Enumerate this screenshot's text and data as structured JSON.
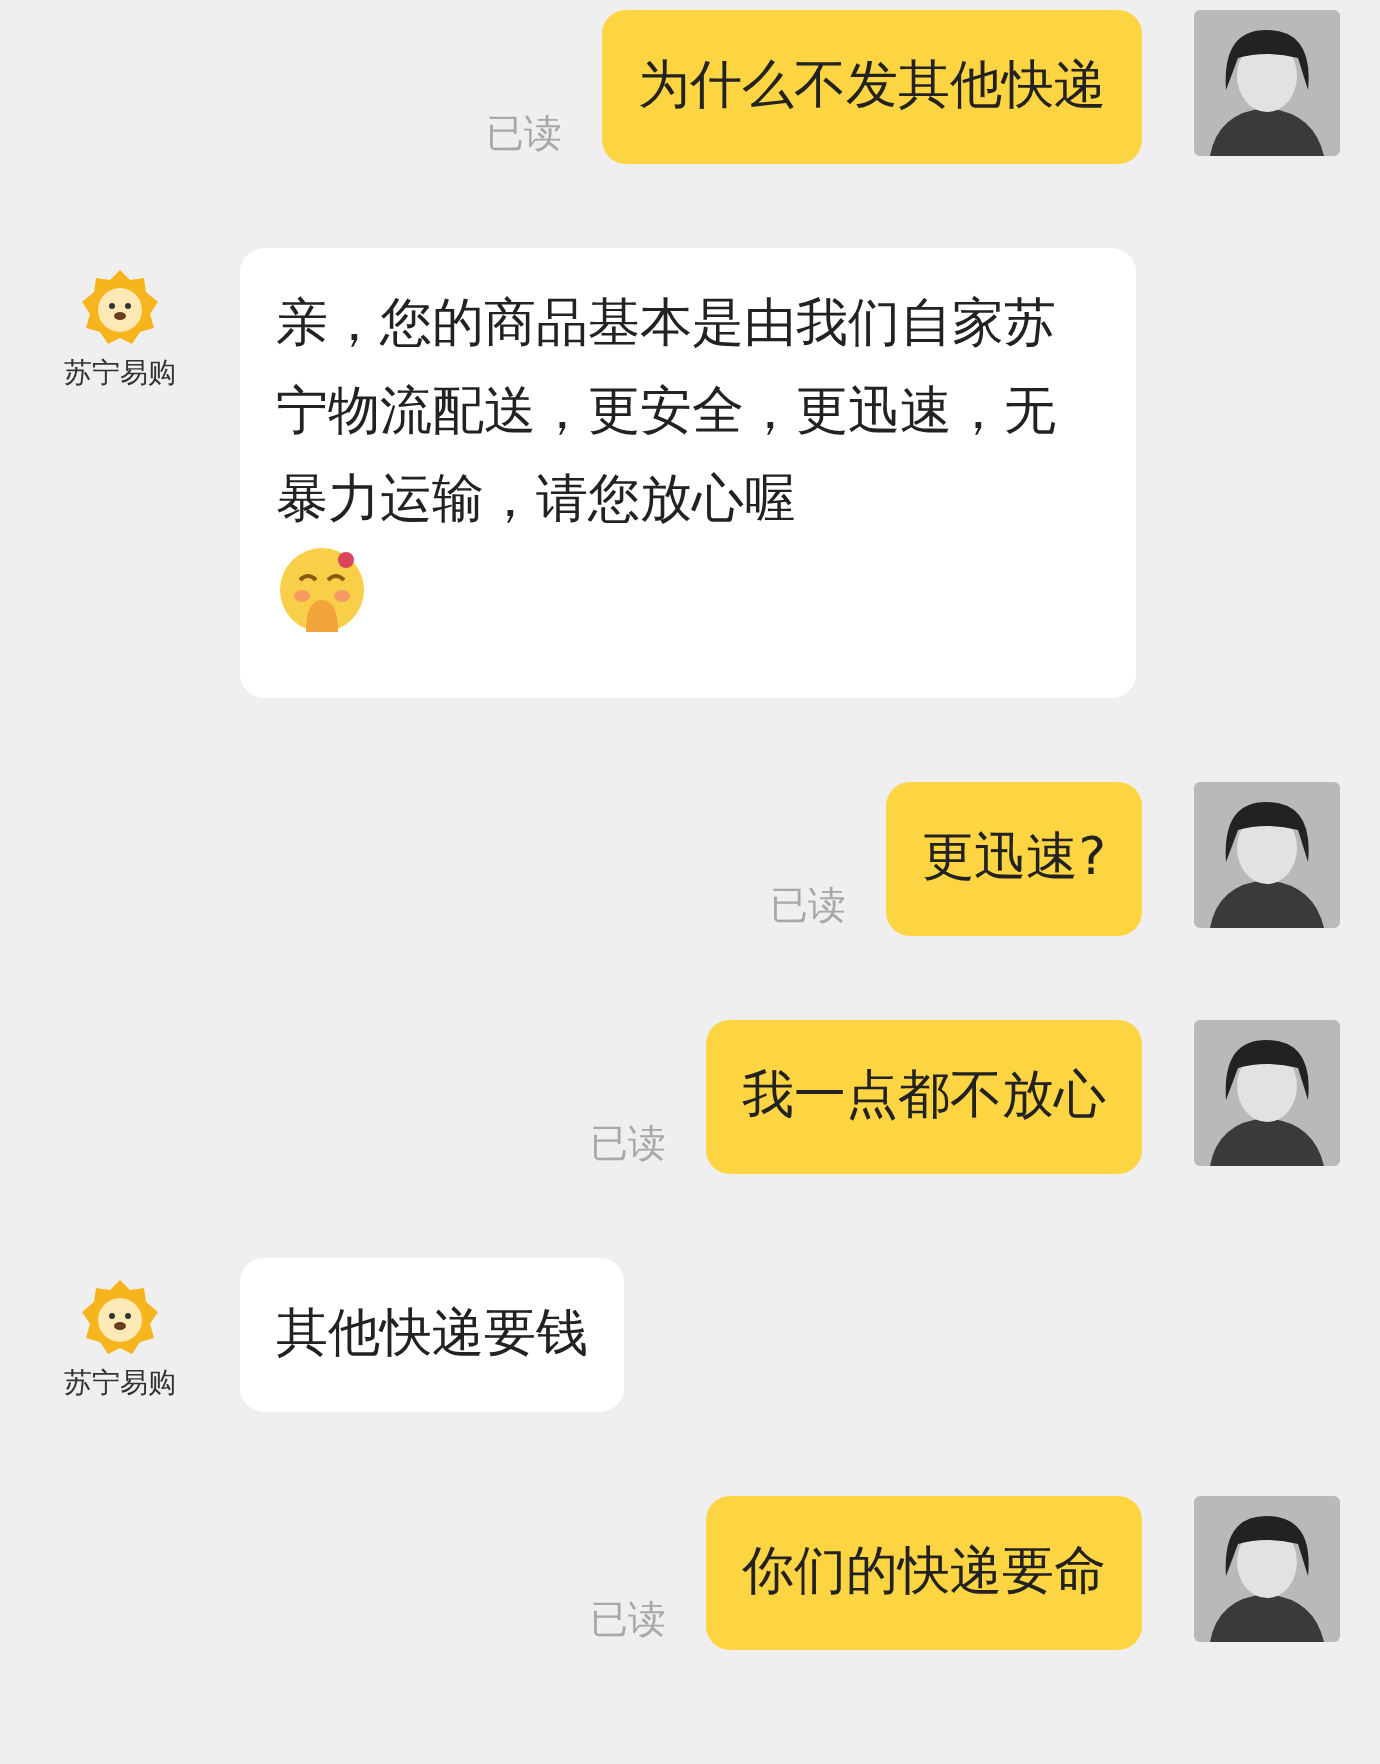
{
  "messages": [
    {
      "kind": "sent",
      "text": "为什么不发其他快递",
      "status": "已读"
    },
    {
      "kind": "received",
      "sender": "苏宁易购",
      "text": "亲，您的商品基本是由我们自家苏宁物流配送，更安全，更迅速，无暴力运输，请您放心喔",
      "emoji": true
    },
    {
      "kind": "sent",
      "text": "更迅速?",
      "status": "已读"
    },
    {
      "kind": "sent",
      "text": "我一点都不放心",
      "status": "已读"
    },
    {
      "kind": "received",
      "sender": "苏宁易购",
      "text": "其他快递要钱",
      "emoji": false
    },
    {
      "kind": "sent",
      "text": "你们的快递要命",
      "status": "已读"
    }
  ]
}
